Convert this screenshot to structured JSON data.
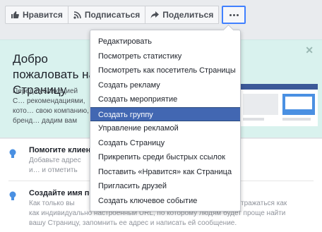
{
  "actionbar": {
    "like_label": "Нравится",
    "follow_label": "Подписаться",
    "share_label": "Поделиться"
  },
  "welcome": {
    "title": "Добро пожаловать на Страницу",
    "text": "Перед публикацией С… рекомендациями, кото… свою компанию, бренд… дадим вам больше ре…"
  },
  "tips": [
    {
      "title": "Помогите клиент",
      "text": "Добавьте адрес и… и отметить посещ…"
    },
    {
      "title": "Создайте имя по",
      "text": "Как только вы соз… как индивидуально настроенный URL, по которому людям будет проще найти вашу Страницу, запомнить ее адрес и написать ей сообщение.",
      "tail": "тражаться как",
      "line2": "как индивидуально настроенный URL, по которому людям будет проще найти",
      "line3": "вашу Страницу, запомнить ее адрес и написать ей сообщение."
    }
  ],
  "menu": {
    "items": [
      {
        "label": "Редактировать"
      },
      {
        "label": "Посмотреть статистику"
      },
      {
        "label": "Посмотреть как посетитель Страницы"
      },
      {
        "label": "Создать рекламу"
      },
      {
        "label": "Создать мероприятие"
      },
      {
        "label": "Создать группу",
        "active": true
      },
      {
        "label": "Управление рекламой"
      },
      {
        "label": "Создать Страницу"
      },
      {
        "label": "Прикрепить среди быстрых ссылок"
      },
      {
        "label": "Поставить «Нравится» как Страница"
      },
      {
        "label": "Пригласить друзей"
      },
      {
        "label": "Создать ключевое событие"
      }
    ]
  },
  "colors": {
    "accent": "#4267b2",
    "card_bg": "#d9f2ee",
    "focus_border": "#4080ff"
  }
}
